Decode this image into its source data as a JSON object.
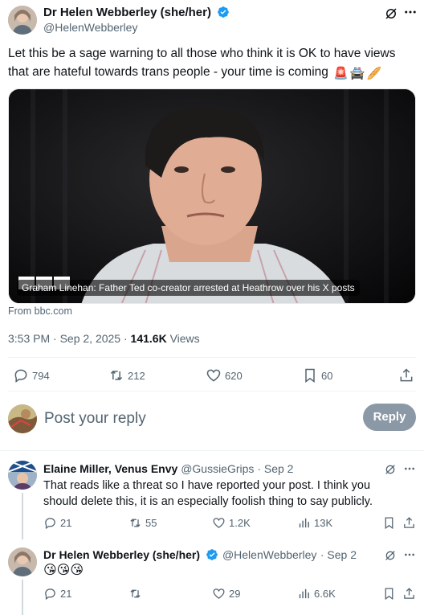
{
  "main_tweet": {
    "author_name": "Dr Helen Webberley (she/her)",
    "handle": "@HelenWebberley",
    "text": "Let this be a sage warning to all those who think it is OK to have views that are hateful towards trans people - your time is coming",
    "emojis": [
      "🚨",
      "🚔",
      "🥖"
    ],
    "media": {
      "caption": "Graham Linehan: Father Ted co-creator arrested at Heathrow over his X posts",
      "source": "From bbc.com"
    },
    "time": "3:53 PM · Sep 2, 2025 ·",
    "views_count": "141.6K",
    "views_label": "Views",
    "stats": {
      "replies": "794",
      "reposts": "212",
      "likes": "620",
      "bookmarks": "60"
    }
  },
  "compose": {
    "placeholder": "Post your reply",
    "button_label": "Reply"
  },
  "replies": [
    {
      "author_name": "Elaine Miller, Venus Envy",
      "handle": "@GussieGrips",
      "date": "· Sep 2",
      "text": "That reads like a threat so I have reported your post.  I think you should delete this, it is an especially foolish thing to say publicly.",
      "stats": {
        "replies": "21",
        "reposts": "55",
        "likes": "1.2K",
        "views": "13K"
      }
    },
    {
      "author_name": "Dr Helen Webberley (she/her)",
      "handle": "@HelenWebberley",
      "date": "· Sep 2",
      "emojis": "😘😘😘",
      "stats": {
        "replies": "21",
        "reposts": "",
        "likes": "29",
        "views": "6.6K"
      }
    }
  ],
  "colors": {
    "verified": "#1d9bf0",
    "muted": "#536471",
    "divider": "#eff3f4",
    "reply_button": "#8b98a5"
  }
}
